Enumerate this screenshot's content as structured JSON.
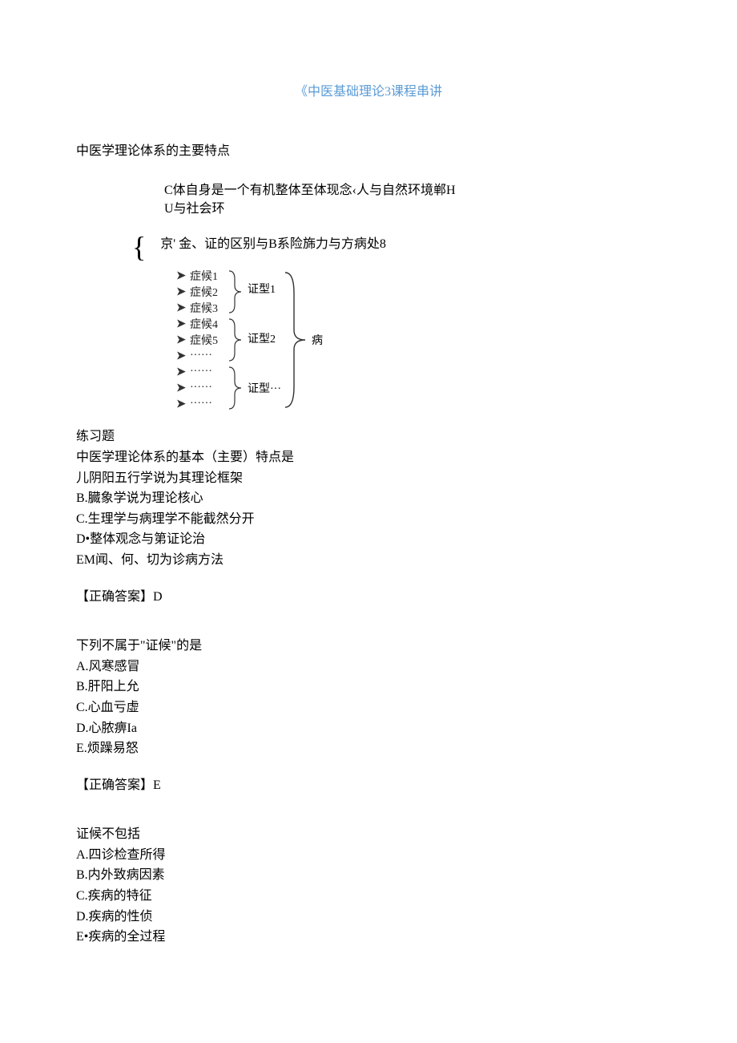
{
  "title": "《中医基础理论3课程串讲",
  "heading": "中医学理论体系的主要特点",
  "concept_block": {
    "line1": "C体自身是一个有机整体至体现念‹人与自然环境郸H",
    "line2": "U与社会环"
  },
  "concept_row2": "京' 金、证的区别与B系险旆力与方病处8",
  "diagram": {
    "rows": [
      "症候1",
      "症候2",
      "症候3",
      "症候4",
      "症候5",
      "······",
      "······",
      "······",
      "······"
    ],
    "group1_label": "证型1",
    "group2_label": "证型2",
    "group3_label": "证型···",
    "result_label": "病"
  },
  "exercise_label": "练习题",
  "q1": {
    "stem": "中医学理论体系的基本（主要）特点是",
    "optA": "儿阴阳五行学说为其理论框架",
    "optB": "B.臓象学说为理论核心",
    "optC": "C.生理学与病理学不能截然分开",
    "optD": "D•整体观念与第证论治",
    "optE": "EM闻、何、切为诊病方法",
    "answer": "【正确答案】D"
  },
  "q2": {
    "stem": "下列不属于\"证候\"的是",
    "optA": "A.风寒感冒",
    "optB": "B.肝阳上允",
    "optC": "C.心血亏虚",
    "optD": "D.心脓痹Ia",
    "optE": "E.烦躁易怒",
    "answer": "【正确答案】E"
  },
  "q3": {
    "stem": "证候不包括",
    "optA": "A.四诊检查所得",
    "optB": "B.内外致病因素",
    "optC": "C.疾病的特征",
    "optD": "D.疾病的性侦",
    "optE": "E•疾病的全过程"
  }
}
